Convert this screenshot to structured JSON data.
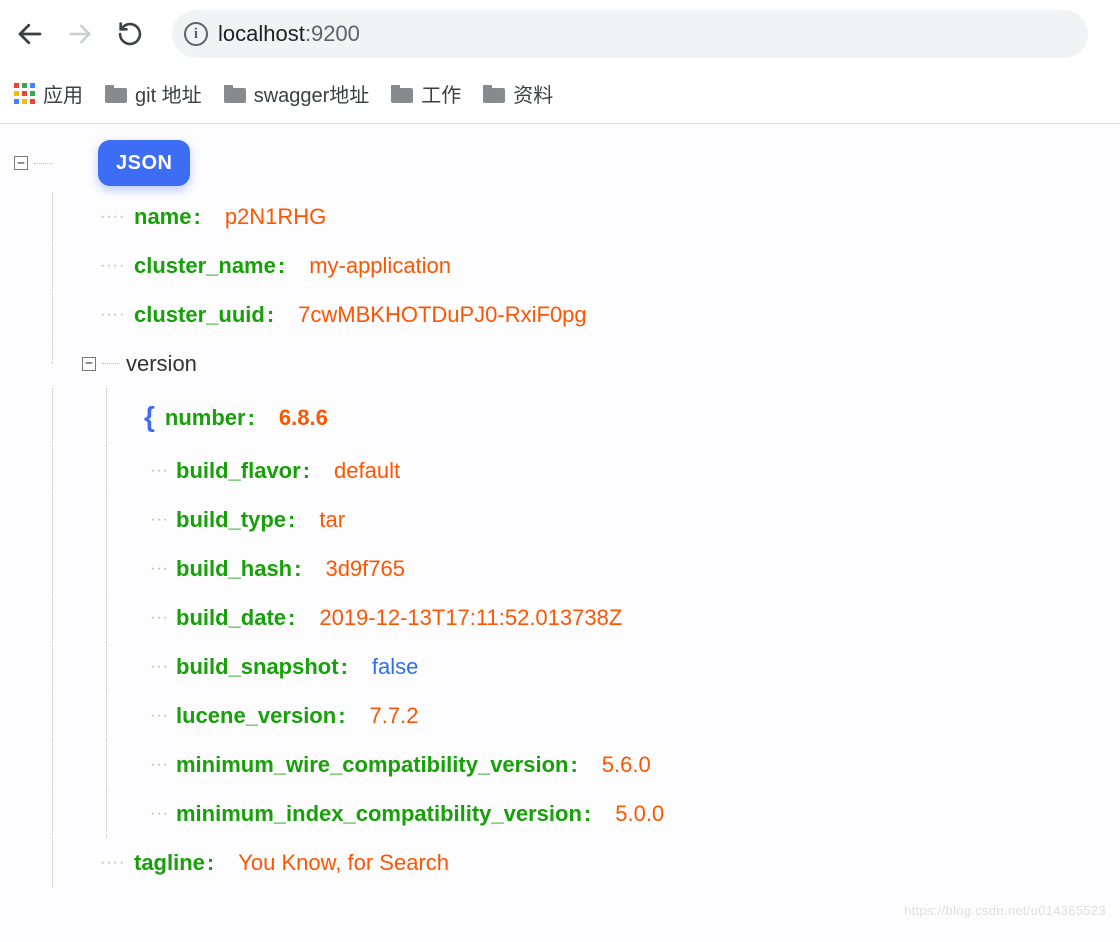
{
  "browser": {
    "url_host": "localhost",
    "url_port": ":9200"
  },
  "bookmarks": {
    "apps_label": "应用",
    "items": [
      {
        "label": "git 地址"
      },
      {
        "label": "swagger地址"
      },
      {
        "label": "工作"
      },
      {
        "label": "资料"
      }
    ]
  },
  "json": {
    "badge": "JSON",
    "fields": {
      "name": {
        "key": "name",
        "value": "p2N1RHG"
      },
      "cluster_name": {
        "key": "cluster_name",
        "value": "my-application"
      },
      "cluster_uuid": {
        "key": "cluster_uuid",
        "value": "7cwMBKHOTDuPJ0-RxiF0pg"
      },
      "version_label": "version",
      "version": {
        "number": {
          "key": "number",
          "value": "6.8.6"
        },
        "build_flavor": {
          "key": "build_flavor",
          "value": "default"
        },
        "build_type": {
          "key": "build_type",
          "value": "tar"
        },
        "build_hash": {
          "key": "build_hash",
          "value": "3d9f765"
        },
        "build_date": {
          "key": "build_date",
          "value": "2019-12-13T17:11:52.013738Z"
        },
        "build_snapshot": {
          "key": "build_snapshot",
          "value": "false"
        },
        "lucene_version": {
          "key": "lucene_version",
          "value": "7.7.2"
        },
        "minimum_wire_compatibility_version": {
          "key": "minimum_wire_compatibility_version",
          "value": "5.6.0"
        },
        "minimum_index_compatibility_version": {
          "key": "minimum_index_compatibility_version",
          "value": "5.0.0"
        }
      },
      "tagline": {
        "key": "tagline",
        "value": "You Know, for Search"
      }
    }
  },
  "watermark": "https://blog.csdn.net/u014365523"
}
